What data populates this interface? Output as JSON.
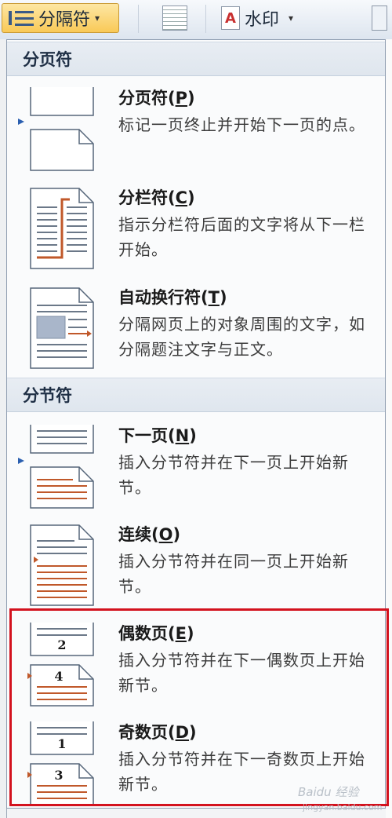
{
  "ribbon": {
    "breaks_label": "分隔符",
    "watermark_label": "水印"
  },
  "menu": {
    "page_breaks_header": "分页符",
    "section_breaks_header": "分节符",
    "items": [
      {
        "title": "分页符",
        "key": "P",
        "desc": "标记一页终止并开始下一页的点。"
      },
      {
        "title": "分栏符",
        "key": "C",
        "desc": "指示分栏符后面的文字将从下一栏开始。"
      },
      {
        "title": "自动换行符",
        "key": "T",
        "desc": "分隔网页上的对象周围的文字，如分隔题注文字与正文。"
      },
      {
        "title": "下一页",
        "key": "N",
        "desc": "插入分节符并在下一页上开始新节。"
      },
      {
        "title": "连续",
        "key": "O",
        "desc": "插入分节符并在同一页上开始新节。"
      },
      {
        "title": "偶数页",
        "key": "E",
        "desc": "插入分节符并在下一偶数页上开始新节。"
      },
      {
        "title": "奇数页",
        "key": "D",
        "desc": "插入分节符并在下一奇数页上开始新节。"
      }
    ],
    "even_icon_numbers": [
      "2",
      "4"
    ],
    "odd_icon_numbers": [
      "1",
      "3"
    ]
  },
  "watermark": {
    "brand": "Baidu 经验",
    "url": "jingyan.baidu.com"
  },
  "colors": {
    "highlight": "#d3121e",
    "break_mark": "#c0582a",
    "arrow": "#2b5fb0"
  }
}
